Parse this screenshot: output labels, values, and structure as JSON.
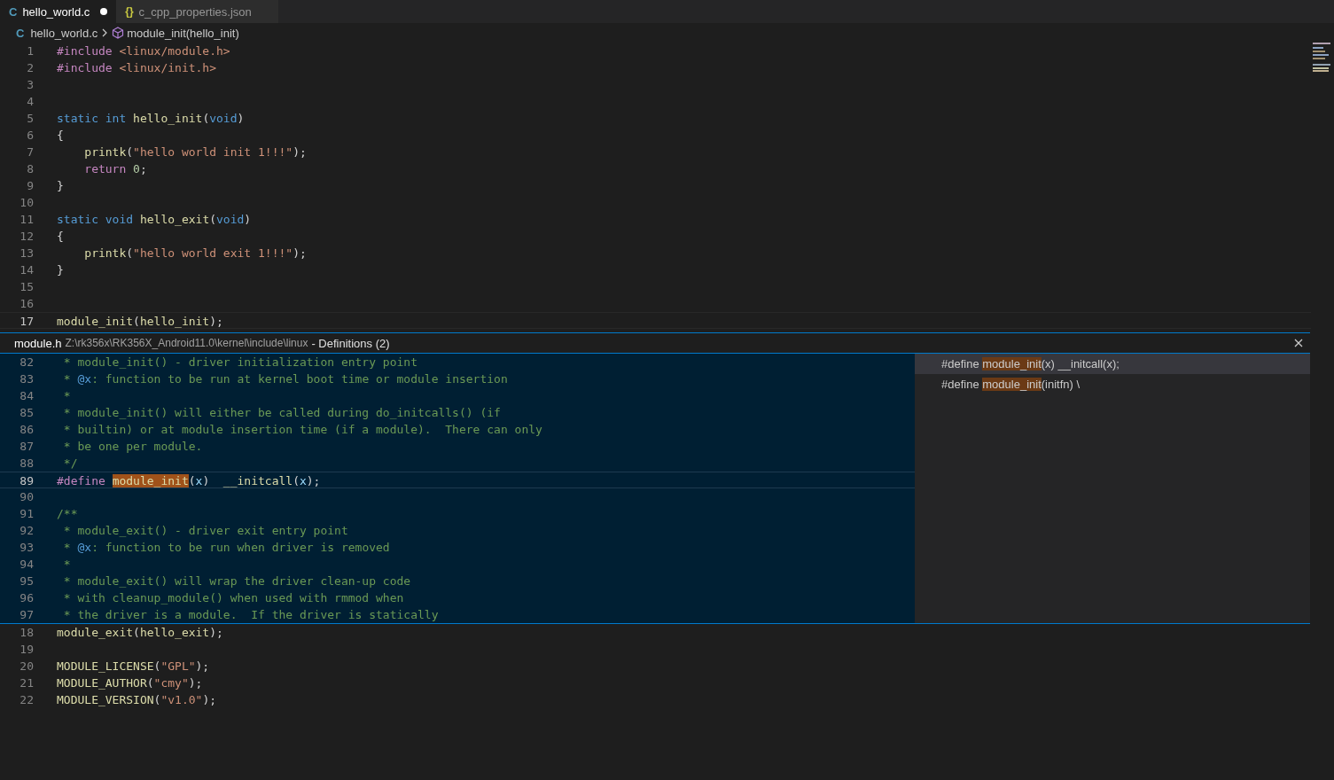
{
  "tabs": [
    {
      "icon": "C",
      "label": "hello_world.c",
      "selected": true,
      "modified": true
    },
    {
      "icon": "{}",
      "label": "c_cpp_properties.json",
      "selected": false,
      "modified": false
    }
  ],
  "breadcrumb": [
    {
      "icon": "C",
      "kind": "file",
      "label": "hello_world.c"
    },
    {
      "kind": "symbol",
      "label": "module_init(hello_init)"
    }
  ],
  "editor_top": {
    "lines": [
      {
        "number": "1",
        "current": false,
        "tokens": [
          {
            "text": "#include ",
            "kind": "directive"
          },
          {
            "text": "<linux/module.h>",
            "kind": "string"
          }
        ]
      },
      {
        "number": "2",
        "current": false,
        "tokens": [
          {
            "text": "#include ",
            "kind": "directive"
          },
          {
            "text": "<linux/init.h>",
            "kind": "string"
          }
        ]
      },
      {
        "number": "3",
        "current": false
      },
      {
        "number": "4",
        "current": false
      },
      {
        "number": "5",
        "current": false,
        "tokens": [
          {
            "text": "static ",
            "kind": "keyword"
          },
          {
            "text": "int ",
            "kind": "keyword"
          },
          {
            "text": "hello_init",
            "kind": "function"
          },
          {
            "text": "("
          },
          {
            "text": "void",
            "kind": "keyword"
          },
          {
            "text": ")"
          }
        ]
      },
      {
        "number": "6",
        "current": false,
        "tokens": [
          {
            "text": "{"
          }
        ]
      },
      {
        "number": "7",
        "current": false,
        "tokens": [
          {
            "text": "    printk",
            "kind": "function"
          },
          {
            "text": "("
          },
          {
            "text": "\"hello world init 1!!!\"",
            "kind": "string"
          },
          {
            "text": ");"
          }
        ]
      },
      {
        "number": "8",
        "current": false,
        "tokens": [
          {
            "text": "    return ",
            "kind": "control"
          },
          {
            "text": "0",
            "kind": "number"
          },
          {
            "text": ";"
          }
        ]
      },
      {
        "number": "9",
        "current": false,
        "tokens": [
          {
            "text": "}"
          }
        ]
      },
      {
        "number": "10",
        "current": false
      },
      {
        "number": "11",
        "current": false,
        "tokens": [
          {
            "text": "static ",
            "kind": "keyword"
          },
          {
            "text": "void ",
            "kind": "keyword"
          },
          {
            "text": "hello_exit",
            "kind": "function"
          },
          {
            "text": "("
          },
          {
            "text": "void",
            "kind": "keyword"
          },
          {
            "text": ")"
          }
        ]
      },
      {
        "number": "12",
        "current": false,
        "tokens": [
          {
            "text": "{"
          }
        ]
      },
      {
        "number": "13",
        "current": false,
        "tokens": [
          {
            "text": "    printk",
            "kind": "function"
          },
          {
            "text": "("
          },
          {
            "text": "\"hello world exit 1!!!\"",
            "kind": "string"
          },
          {
            "text": ");"
          }
        ]
      },
      {
        "number": "14",
        "current": false,
        "tokens": [
          {
            "text": "}"
          }
        ]
      },
      {
        "number": "15",
        "current": false
      },
      {
        "number": "16",
        "current": false
      },
      {
        "number": "17",
        "current": true,
        "tokens": [
          {
            "text": "module_init",
            "kind": "function"
          },
          {
            "text": "("
          },
          {
            "text": "hello_init",
            "kind": "function"
          },
          {
            "text": ");"
          }
        ]
      }
    ]
  },
  "peek": {
    "file": "module.h",
    "path": "Z:\\rk356x\\RK356X_Android11.0\\kernel\\include\\linux",
    "title": "- Definitions (2)",
    "lines": [
      {
        "number": "82",
        "current": false,
        "tokens": [
          {
            "text": " * module_init() - driver initialization entry point",
            "kind": "comment"
          }
        ]
      },
      {
        "number": "83",
        "current": false,
        "tokens": [
          {
            "text": " * ",
            "kind": "comment"
          },
          {
            "text": "@x",
            "kind": "doc-tag"
          },
          {
            "text": ": function to be run at kernel boot time or module insertion",
            "kind": "comment"
          }
        ]
      },
      {
        "number": "84",
        "current": false,
        "tokens": [
          {
            "text": " *",
            "kind": "comment"
          }
        ]
      },
      {
        "number": "85",
        "current": false,
        "tokens": [
          {
            "text": " * module_init() will either be called during do_initcalls() (if",
            "kind": "comment"
          }
        ]
      },
      {
        "number": "86",
        "current": false,
        "tokens": [
          {
            "text": " * builtin) or at module insertion time (if a module).  There can only",
            "kind": "comment"
          }
        ]
      },
      {
        "number": "87",
        "current": false,
        "tokens": [
          {
            "text": " * be one per module.",
            "kind": "comment"
          }
        ]
      },
      {
        "number": "88",
        "current": false,
        "tokens": [
          {
            "text": " */",
            "kind": "comment"
          }
        ]
      },
      {
        "number": "89",
        "current": true,
        "tokens": [
          {
            "text": "#define ",
            "kind": "directive"
          },
          {
            "text": "module_init",
            "kind": "function",
            "highlight": true
          },
          {
            "text": "("
          },
          {
            "text": "x",
            "kind": "param"
          },
          {
            "text": ")  "
          },
          {
            "text": "__initcall",
            "kind": "function"
          },
          {
            "text": "("
          },
          {
            "text": "x",
            "kind": "param"
          },
          {
            "text": ");"
          }
        ]
      },
      {
        "number": "90",
        "current": false
      },
      {
        "number": "91",
        "current": false,
        "tokens": [
          {
            "text": "/**",
            "kind": "comment"
          }
        ]
      },
      {
        "number": "92",
        "current": false,
        "tokens": [
          {
            "text": " * module_exit() - driver exit entry point",
            "kind": "comment"
          }
        ]
      },
      {
        "number": "93",
        "current": false,
        "tokens": [
          {
            "text": " * ",
            "kind": "comment"
          },
          {
            "text": "@x",
            "kind": "doc-tag"
          },
          {
            "text": ": function to be run when driver is removed",
            "kind": "comment"
          }
        ]
      },
      {
        "number": "94",
        "current": false,
        "tokens": [
          {
            "text": " *",
            "kind": "comment"
          }
        ]
      },
      {
        "number": "95",
        "current": false,
        "tokens": [
          {
            "text": " * module_exit() will wrap the driver clean-up code",
            "kind": "comment"
          }
        ]
      },
      {
        "number": "96",
        "current": false,
        "tokens": [
          {
            "text": " * with cleanup_module() when used with rmmod when",
            "kind": "comment"
          }
        ]
      },
      {
        "number": "97",
        "current": false,
        "tokens": [
          {
            "text": " * the driver is a module.  If the driver is statically",
            "kind": "comment"
          }
        ]
      }
    ],
    "references": [
      {
        "selected": true,
        "tokens": [
          {
            "text": "#define "
          },
          {
            "text": "module_init",
            "highlight": true
          },
          {
            "text": "(x) __initcall(x);"
          }
        ]
      },
      {
        "selected": false,
        "tokens": [
          {
            "text": "#define "
          },
          {
            "text": "module_init",
            "highlight": true
          },
          {
            "text": "(initfn) \\"
          }
        ]
      }
    ]
  },
  "editor_bottom": {
    "lines": [
      {
        "number": "18",
        "current": false,
        "tokens": [
          {
            "text": "module_exit",
            "kind": "function"
          },
          {
            "text": "("
          },
          {
            "text": "hello_exit",
            "kind": "function"
          },
          {
            "text": ");"
          }
        ]
      },
      {
        "number": "19",
        "current": false
      },
      {
        "number": "20",
        "current": false,
        "tokens": [
          {
            "text": "MODULE_LICENSE",
            "kind": "function"
          },
          {
            "text": "("
          },
          {
            "text": "\"GPL\"",
            "kind": "string"
          },
          {
            "text": ");"
          }
        ]
      },
      {
        "number": "21",
        "current": false,
        "tokens": [
          {
            "text": "MODULE_AUTHOR",
            "kind": "function"
          },
          {
            "text": "("
          },
          {
            "text": "\"cmy\"",
            "kind": "string"
          },
          {
            "text": ");"
          }
        ]
      },
      {
        "number": "22",
        "current": false,
        "tokens": [
          {
            "text": "MODULE_VERSION",
            "kind": "function"
          },
          {
            "text": "("
          },
          {
            "text": "\"v1.0\"",
            "kind": "string"
          },
          {
            "text": ");"
          }
        ]
      }
    ]
  }
}
